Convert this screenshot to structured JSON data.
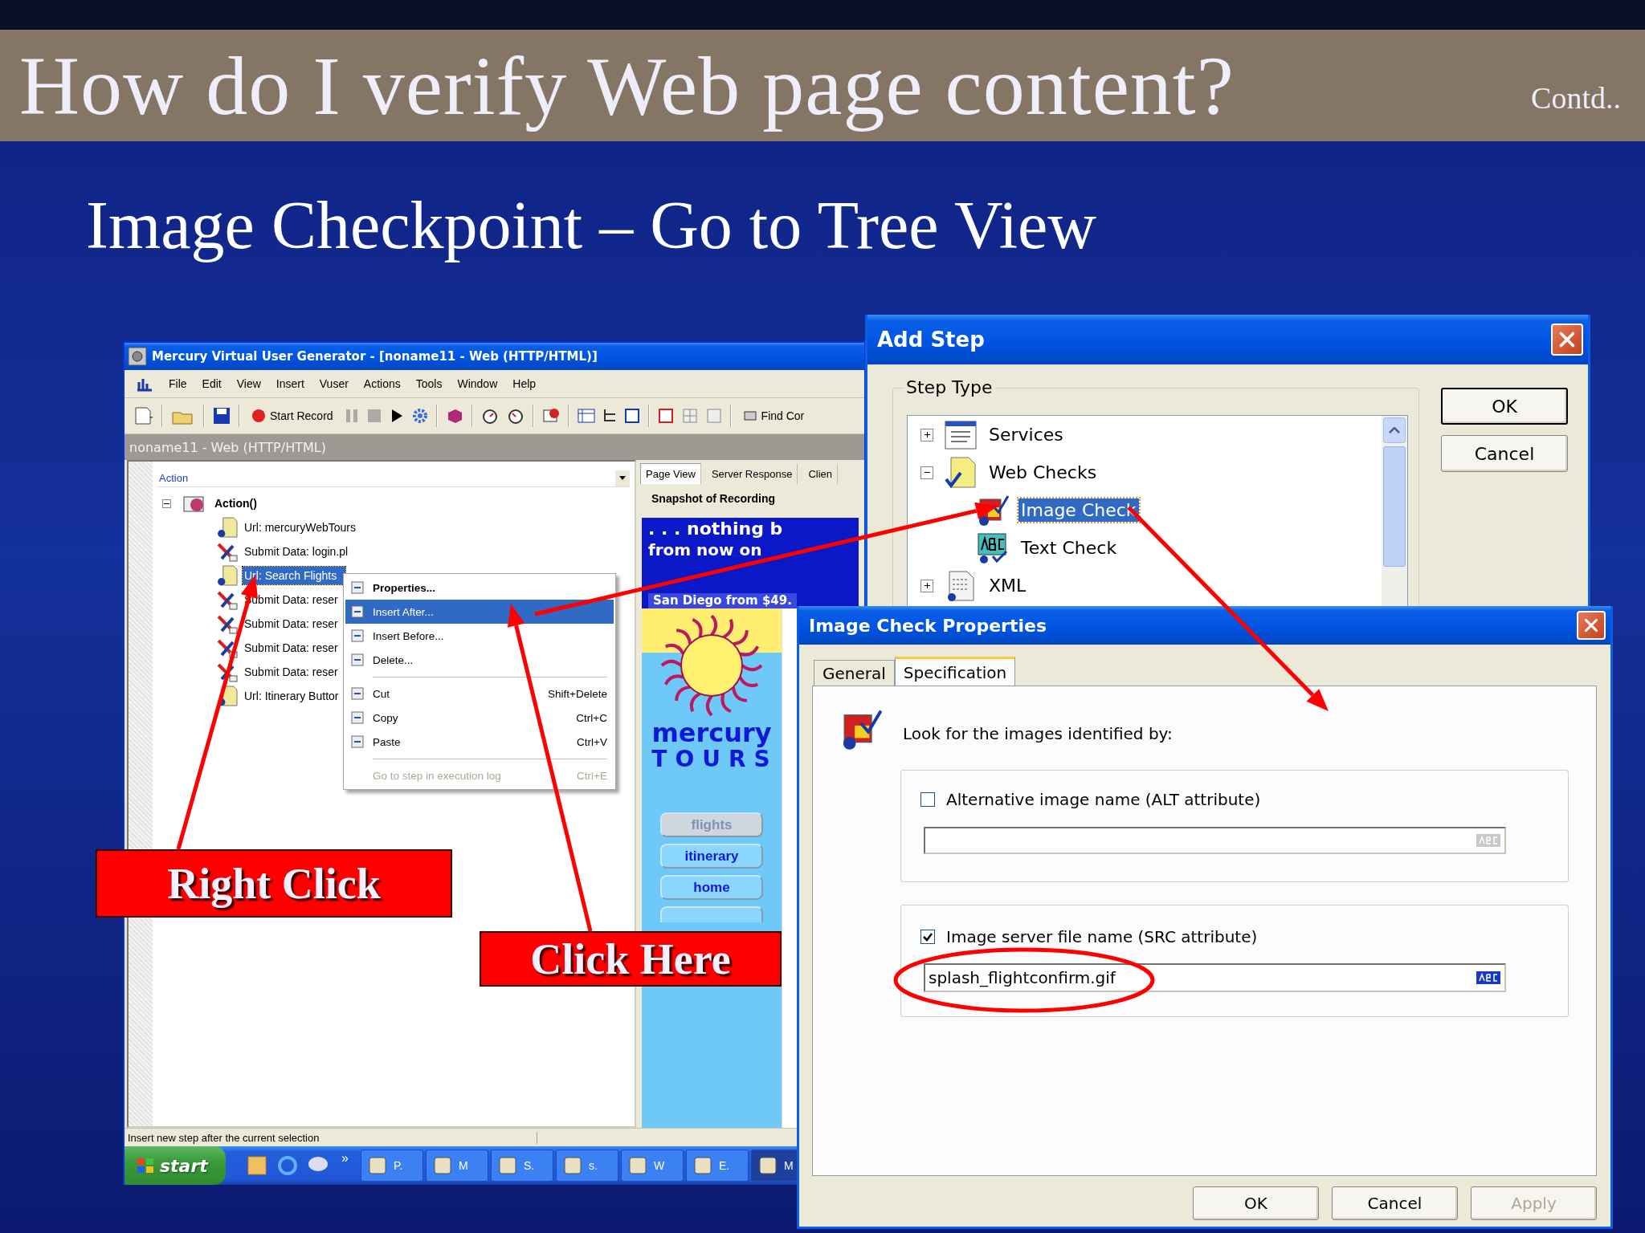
{
  "slide": {
    "title": "How do I verify Web page content?",
    "note": "Contd..",
    "subtitle": "Image Checkpoint – Go to Tree View"
  },
  "vugen": {
    "title": "Mercury Virtual User Generator - [noname11 - Web (HTTP/HTML)]",
    "menu": [
      "File",
      "Edit",
      "View",
      "Insert",
      "Vuser",
      "Actions",
      "Tools",
      "Window",
      "Help"
    ],
    "toolbar": {
      "record": "Start Record",
      "find": "Find Cor"
    },
    "document_title": "noname11 - Web (HTTP/HTML)",
    "action_selector": "Action",
    "tree": {
      "label": "Action()",
      "expanded": true,
      "children": [
        {
          "label": "Url: mercuryWebTours",
          "kind": "url",
          "selected": false
        },
        {
          "label": "Submit Data: login.pl",
          "kind": "submit",
          "selected": false
        },
        {
          "label": "Url: Search Flights",
          "kind": "url",
          "selected": true
        },
        {
          "label": "Submit Data: reser",
          "kind": "submit",
          "selected": false
        },
        {
          "label": "Submit Data: reser",
          "kind": "submit",
          "selected": false
        },
        {
          "label": "Submit Data: reser",
          "kind": "submit",
          "selected": false
        },
        {
          "label": "Submit Data: reser",
          "kind": "submit",
          "selected": false
        },
        {
          "label": "Url: Itinerary Buttor",
          "kind": "url",
          "selected": false
        }
      ]
    },
    "context_menu": [
      {
        "kind": "item",
        "label": "Properties...",
        "default": true,
        "selected": false,
        "disabled": false
      },
      {
        "kind": "item",
        "label": "Insert After...",
        "default": false,
        "selected": true,
        "disabled": false
      },
      {
        "kind": "item",
        "label": "Insert Before...",
        "default": false,
        "selected": false,
        "disabled": false
      },
      {
        "kind": "item",
        "label": "Delete...",
        "default": false,
        "selected": false,
        "disabled": false
      },
      {
        "kind": "separator"
      },
      {
        "kind": "item",
        "label": "Cut",
        "shortcut": "Shift+Delete",
        "default": false,
        "selected": false,
        "disabled": false
      },
      {
        "kind": "item",
        "label": "Copy",
        "shortcut": "Ctrl+C",
        "default": false,
        "selected": false,
        "disabled": false
      },
      {
        "kind": "item",
        "label": "Paste",
        "shortcut": "Ctrl+V",
        "default": false,
        "selected": false,
        "disabled": false
      },
      {
        "kind": "separator"
      },
      {
        "kind": "item",
        "label": "Go to step in execution log",
        "shortcut": "Ctrl+E",
        "default": false,
        "selected": false,
        "disabled": true
      }
    ],
    "tabs": [
      {
        "label": "Page View",
        "selected": true
      },
      {
        "label": "Server Response",
        "selected": false
      },
      {
        "label": "Clien",
        "selected": false
      }
    ],
    "snapshot_title": "Snapshot of Recording",
    "banner": [
      ". . . nothing b",
      "from now on",
      "San Diego from $49."
    ],
    "brand": {
      "name": "mercury",
      "tagline": "TOURS"
    },
    "nav_buttons": [
      {
        "label": "flights",
        "selected": true
      },
      {
        "label": "itinerary",
        "selected": false
      },
      {
        "label": "home",
        "selected": false
      }
    ],
    "status": "Insert new step after the current selection",
    "taskbar": {
      "start": "start",
      "overflow": "»",
      "tasks": [
        {
          "label": "P.",
          "selected": false
        },
        {
          "label": "M",
          "selected": false
        },
        {
          "label": "S.",
          "selected": false
        },
        {
          "label": "s.",
          "selected": false
        },
        {
          "label": "W",
          "selected": false
        },
        {
          "label": "E.",
          "selected": false
        },
        {
          "label": "M",
          "selected": true
        }
      ]
    }
  },
  "add_step": {
    "title": "Add Step",
    "group": "Step Type",
    "tree": [
      {
        "label": "Services",
        "kind": "services",
        "expanded": false,
        "selected": false
      },
      {
        "label": "Web Checks",
        "kind": "folder",
        "expanded": true,
        "selected": false,
        "children": [
          {
            "label": "Image Check",
            "kind": "image",
            "selected": true
          },
          {
            "label": "Text Check",
            "kind": "text",
            "selected": false
          }
        ]
      },
      {
        "label": "XML",
        "kind": "xml",
        "expanded": false,
        "selected": false
      }
    ],
    "buttons": [
      "OK",
      "Cancel"
    ]
  },
  "image_check": {
    "title": "Image Check Properties",
    "tabs": [
      {
        "label": "General",
        "selected": false
      },
      {
        "label": "Specification",
        "selected": true
      }
    ],
    "prompt": "Look for the images identified by:",
    "options": [
      {
        "label": "Alternative image name (ALT attribute)",
        "checked": false
      },
      {
        "label": "Image server file name (SRC attribute)",
        "checked": true,
        "value": "splash_flightconfirm.gif"
      }
    ],
    "buttons": [
      {
        "label": "OK",
        "disabled": false
      },
      {
        "label": "Cancel",
        "disabled": false
      },
      {
        "label": "Apply",
        "disabled": true
      }
    ]
  },
  "callouts": [
    {
      "label": "Right Click"
    },
    {
      "label": "Click Here"
    }
  ]
}
